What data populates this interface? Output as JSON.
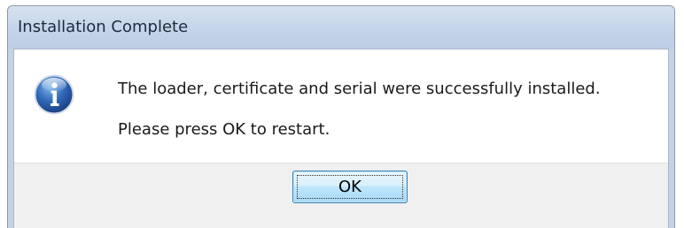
{
  "window": {
    "title": "Installation Complete"
  },
  "message": {
    "icon": "info-icon",
    "line1": "The loader, certificate and serial were successfully installed.",
    "line2": "Please press OK to restart."
  },
  "buttons": {
    "ok_label": "OK"
  },
  "colors": {
    "titlebar": "#c4d4e9",
    "button_area": "#f0f0f0",
    "icon_blue": "#2a5fa8"
  }
}
